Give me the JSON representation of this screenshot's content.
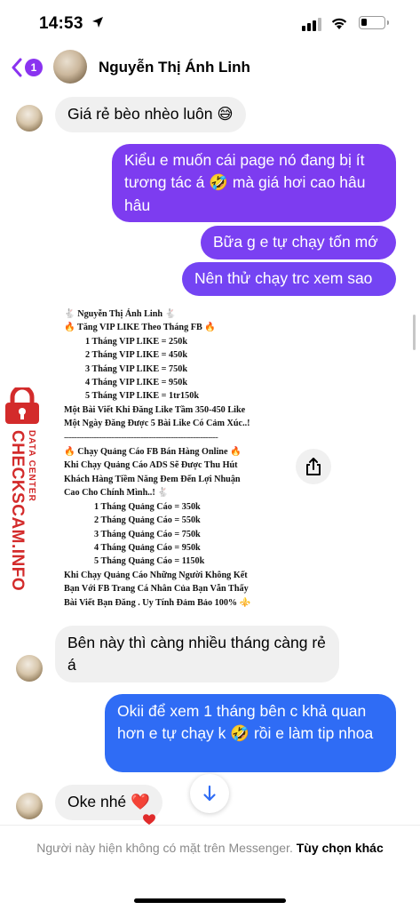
{
  "status": {
    "time": "14:53"
  },
  "header": {
    "unread_count": "1",
    "contact_name": "Nguyễn Thị Ánh Linh"
  },
  "colors": {
    "accent": "#8a33f0",
    "out_purple": "#7d3cf0",
    "out_blue": "#2f6cf5",
    "incoming_bg": "#f0f0f0"
  },
  "messages": [
    {
      "dir": "in",
      "text": "Giá rẻ bèo nhèo luôn",
      "emoji": "😅"
    },
    {
      "dir": "out",
      "text_before": "Kiểu e muốn cái page nó đang bị ít tương tác á",
      "emoji": "🤣",
      "text_after": "mà giá hơi cao hâu hâu"
    },
    {
      "dir": "out",
      "text": "Bữa g e tự chạy tốn mớ"
    },
    {
      "dir": "out",
      "text": "Nên thử chạy trc xem sao"
    },
    {
      "dir": "in",
      "text": "Bên này thì càng nhiều tháng càng rẻ á"
    },
    {
      "dir": "out",
      "text_before": "Okii để xem 1 tháng bên c khả quan hơn e tự chạy k",
      "emoji": "🤣",
      "text_after": "rồi e làm tip nhoa"
    },
    {
      "dir": "in",
      "text": "Oke nhé",
      "emoji": "❤️"
    }
  ],
  "promo": {
    "title": "🐇 Nguyễn Thị Ánh Linh 🐇",
    "vip_heading": "🔥 Tăng VIP LIKE Theo Tháng FB 🔥",
    "vip_plans": [
      "1 Tháng VIP LIKE = 250k",
      "2 Tháng VIP LIKE = 450k",
      "3 Tháng VIP LIKE = 750k",
      "4 Tháng VIP LIKE = 950k",
      "5 Tháng VIP LIKE = 1tr150k"
    ],
    "vip_note_1": "Một Bài Viết Khi Đăng Like Tầm 350-450 Like",
    "vip_note_2": "Một Ngày Đăng Được 5 Bài Like Có Cảm Xúc..!",
    "divider": "--------------------------------------------------------------",
    "ads_heading": "🔥 Chạy Quảng Cáo FB Bán Hàng Online 🔥",
    "ads_desc": [
      "Khi Chạy Quảng Cáo ADS Sẽ Được Thu Hút",
      "Khách Hàng Tiềm Năng Đem Đến Lợi Nhuận",
      "Cao Cho Chính Mình..! 🐇"
    ],
    "ads_plans": [
      "1 Tháng Quảng Cáo = 350k",
      "2 Tháng Quảng Cáo = 550k",
      "3 Tháng Quảng Cáo = 750k",
      "4 Tháng Quảng Cáo = 950k",
      "5 Tháng Quảng Cáo = 1150k"
    ],
    "ads_footer": [
      "Khi Chạy Quảng Cáo Những Người Không Kết",
      "Bạn Với FB Trang Cá Nhân Của Bạn Vẫn Thấy",
      "Bài Viết Bạn Đăng . Uy Tính Đảm Bảo 100% ⚜️"
    ]
  },
  "watermark": {
    "brand": "CHECKSCAM.INFO",
    "sub": "DATA CENTER"
  },
  "footer": {
    "notice": "Người này hiện không có mặt trên Messenger.",
    "action": "Tùy chọn khác"
  }
}
